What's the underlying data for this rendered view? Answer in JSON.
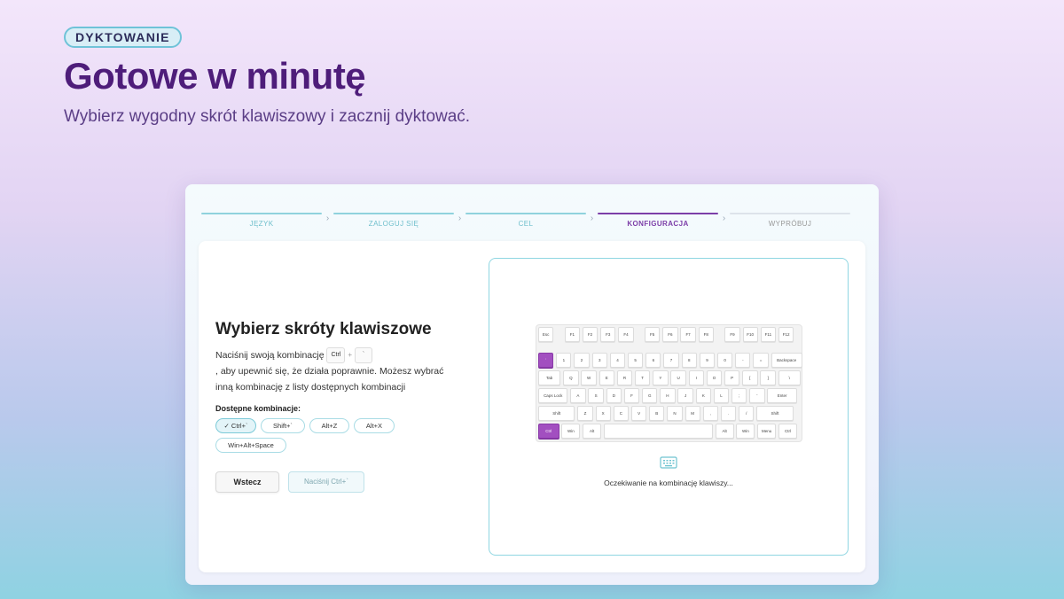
{
  "page": {
    "badge": "DYKTOWANIE",
    "title": "Gotowe w minutę",
    "subtitle": "Wybierz wygodny skrót klawiszowy i zacznij dyktować."
  },
  "steps": [
    {
      "label": "JĘZYK",
      "state": "done"
    },
    {
      "label": "ZALOGUJ SIĘ",
      "state": "done"
    },
    {
      "label": "CEL",
      "state": "done"
    },
    {
      "label": "KONFIGURACJA",
      "state": "active"
    },
    {
      "label": "WYPRÓBUJ",
      "state": "todo"
    }
  ],
  "left": {
    "title": "Wybierz skróty klawiszowe",
    "desc_before": "Naciśnij swoją kombinację",
    "key1": "Ctrl",
    "plus": "+",
    "key2": "`",
    "desc_after": ", aby upewnić się, że działa poprawnie. Możesz wybrać inną kombinację z listy dostępnych kombinacji",
    "available_label": "Dostępne kombinacje:",
    "chips": [
      {
        "label": "Ctrl+`",
        "selected": true,
        "check": "✓"
      },
      {
        "label": "Shift+`",
        "selected": false,
        "check": ""
      },
      {
        "label": "Alt+Z",
        "selected": false,
        "check": ""
      },
      {
        "label": "Alt+X",
        "selected": false,
        "check": ""
      },
      {
        "label": "Win+Alt+Space",
        "selected": false,
        "check": ""
      }
    ],
    "back_label": "Wstecz",
    "next_label": "Naciśnij Ctrl+`"
  },
  "preview": {
    "waiting_text": "Oczekiwanie na kombinację klawiszy...",
    "icon": "keyboard-icon",
    "highlight_color": "#a24fc0"
  },
  "keyboard": {
    "rows": [
      [
        "Esc",
        "F1",
        "F2",
        "F3",
        "F4",
        "F5",
        "F6",
        "F7",
        "F8",
        "F9",
        "F10",
        "F11",
        "F12"
      ],
      [
        "`",
        "1",
        "2",
        "3",
        "4",
        "5",
        "6",
        "7",
        "8",
        "9",
        "0",
        "-",
        "=",
        "Backspace"
      ],
      [
        "Tab",
        "Q",
        "W",
        "E",
        "R",
        "T",
        "Y",
        "U",
        "I",
        "O",
        "P",
        "[",
        "]",
        "\\"
      ],
      [
        "Caps Lock",
        "A",
        "S",
        "D",
        "F",
        "G",
        "H",
        "J",
        "K",
        "L",
        ";",
        "'",
        "Enter"
      ],
      [
        "Shift",
        "Z",
        "X",
        "C",
        "V",
        "B",
        "N",
        "M",
        ",",
        ".",
        "/",
        "Shift"
      ],
      [
        "Ctrl",
        "Win",
        "Alt",
        "",
        "Alt",
        "Win",
        "Menu",
        "Ctrl"
      ]
    ],
    "highlighted": [
      "`",
      "Ctrl"
    ]
  }
}
